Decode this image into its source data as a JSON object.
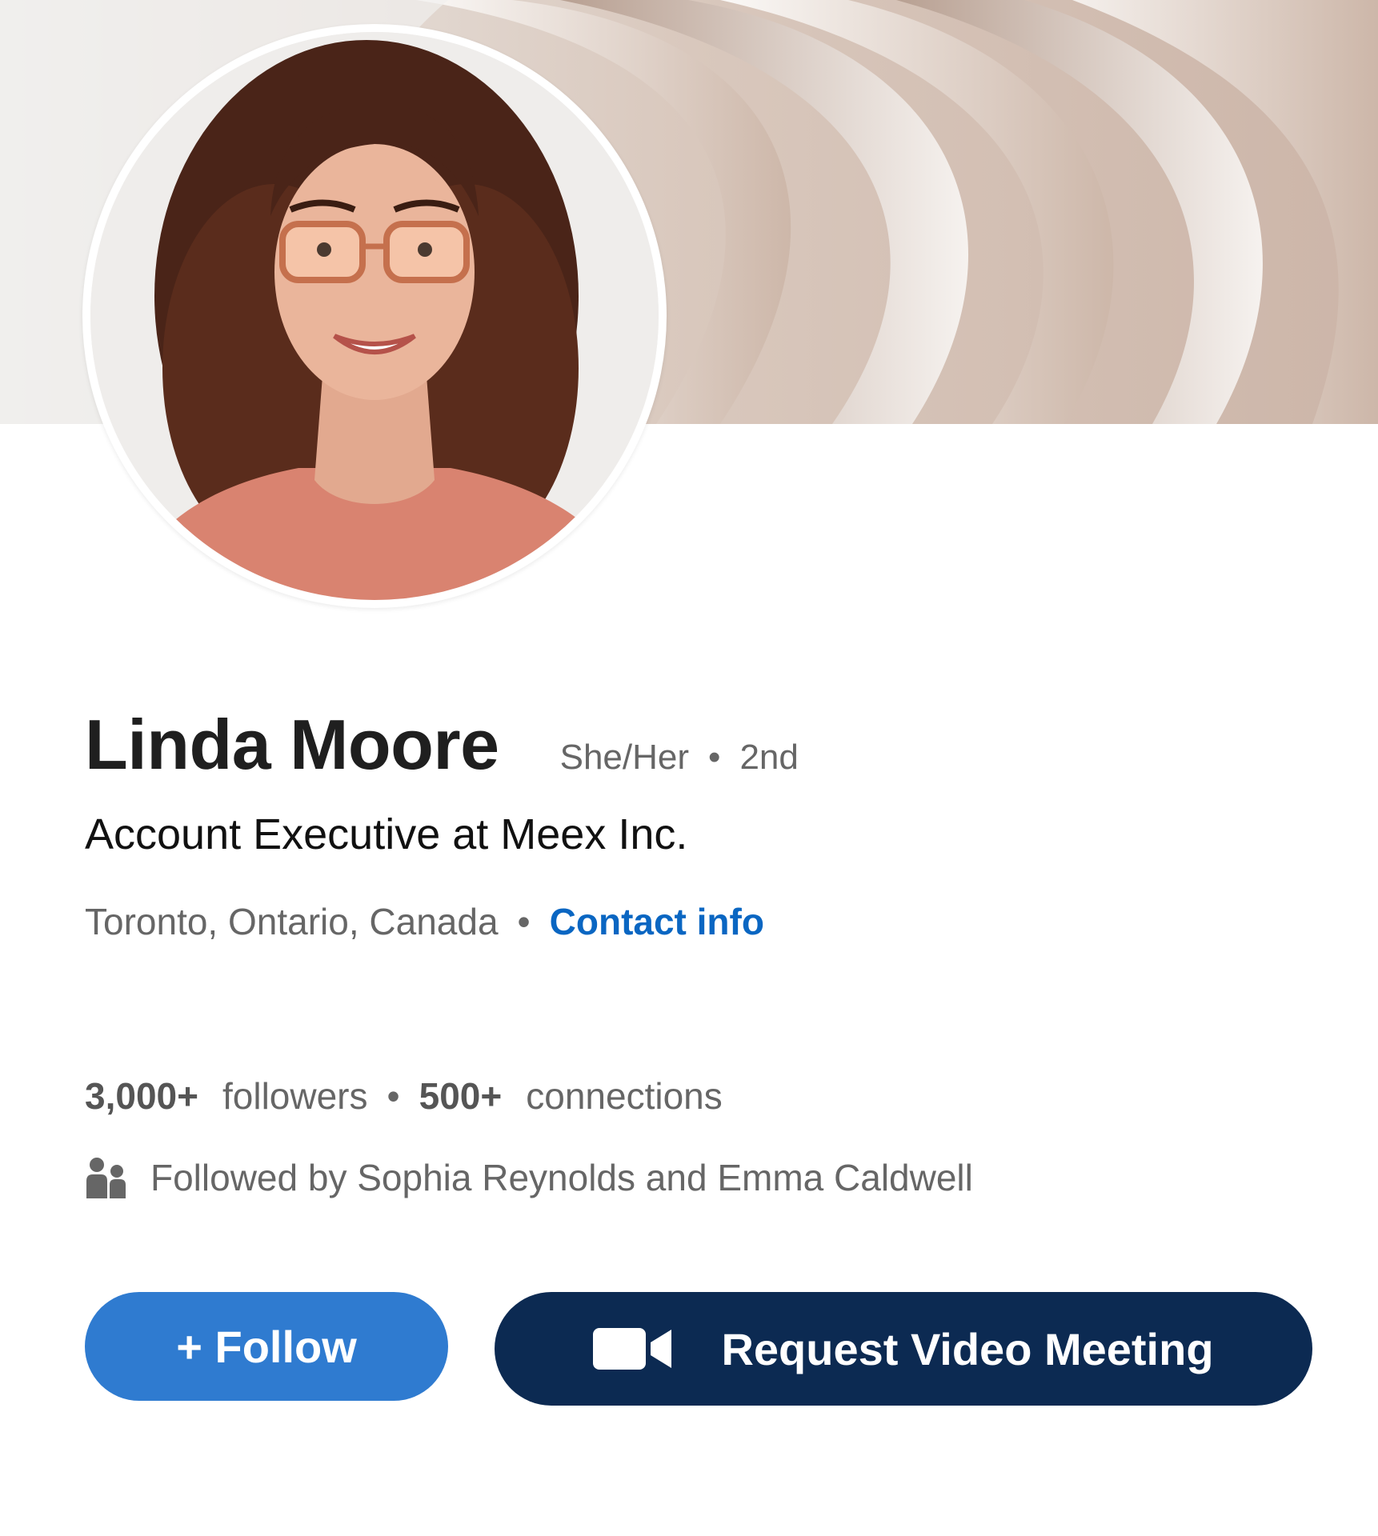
{
  "profile": {
    "name": "Linda Moore",
    "pronouns": "She/Her",
    "degree": "2nd",
    "separator": "•",
    "headline": "Account Executive at Meex Inc.",
    "location": "Toronto, Ontario, Canada",
    "contact_label": "Contact info"
  },
  "stats": {
    "followers_count": "3,000+",
    "followers_label": "followers",
    "connections_count": "500+",
    "connections_label": "connections"
  },
  "followed_by": {
    "text": "Followed by Sophia Reynolds and Emma Caldwell",
    "icon": "people-icon"
  },
  "actions": {
    "follow_label": "+ Follow",
    "meeting_label": "Request Video Meeting",
    "meeting_icon": "video-camera-icon"
  },
  "colors": {
    "link": "#0a66c2",
    "follow_button": "#2f7bd0",
    "meeting_button": "#0c2a52"
  }
}
